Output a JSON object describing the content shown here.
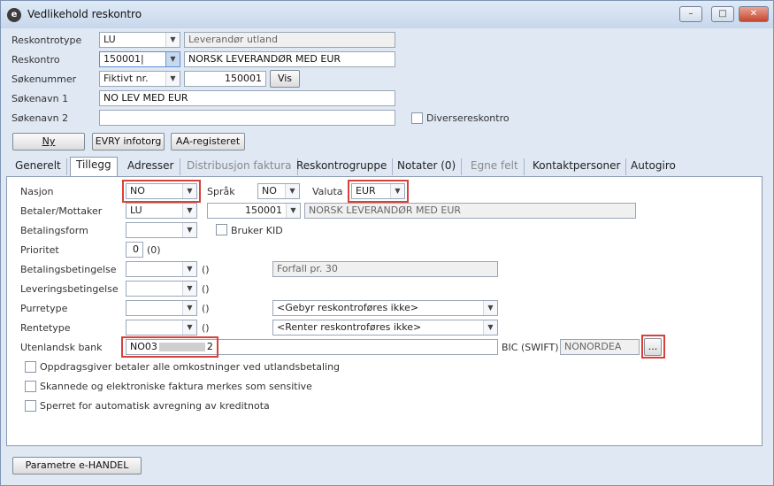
{
  "window": {
    "title": "Vedlikehold reskontro",
    "icon_letter": "e",
    "controls": {
      "minimize": "–",
      "maximize": "□",
      "close": "✕"
    }
  },
  "header": {
    "reskontrotype_label": "Reskontrotype",
    "reskontrotype_value": "LU",
    "reskontrotype_desc": "Leverandør utland",
    "reskontro_label": "Reskontro",
    "reskontro_value": "150001",
    "reskontro_name": "NORSK LEVERANDØR MED EUR",
    "sokenummer_label": "Søkenummer",
    "sokenummer_type": "Fiktivt nr.",
    "sokenummer_value": "150001",
    "vis_button": "Vis",
    "sokenavn1_label": "Søkenavn 1",
    "sokenavn1_value": "NO LEV MED EUR",
    "sokenavn2_label": "Søkenavn 2",
    "sokenavn2_value": "",
    "diverse_label": "Diversereskontro",
    "ny_button": "Ny",
    "evry_button": "EVRY infotorg",
    "aa_button": "AA-registeret"
  },
  "tabs": [
    {
      "label": "Generelt"
    },
    {
      "label": "Tillegg"
    },
    {
      "label": "Adresser"
    },
    {
      "label": "Distribusjon faktura"
    },
    {
      "label": "Reskontrogruppe"
    },
    {
      "label": "Notater (0)"
    },
    {
      "label": "Egne felt"
    },
    {
      "label": "Kontaktpersoner"
    },
    {
      "label": "Autogiro"
    }
  ],
  "tillegg": {
    "nasjon_label": "Nasjon",
    "nasjon_value": "NO",
    "sprak_label": "Språk",
    "sprak_value": "NO",
    "valuta_label": "Valuta",
    "valuta_value": "EUR",
    "betaler_label": "Betaler/Mottaker",
    "betaler_type": "LU",
    "betaler_number": "150001",
    "betaler_name": "NORSK LEVERANDØR MED EUR",
    "betalingsform_label": "Betalingsform",
    "bruker_kid_label": "Bruker KID",
    "prioritet_label": "Prioritet",
    "prioritet_value": "0",
    "prioritet_paren": "(0)",
    "betalingsbet_label": "Betalingsbetingelse",
    "betalingsbet_paren": "()",
    "forfall_text": "Forfall pr. 30",
    "leveringsbet_label": "Leveringsbetingelse",
    "leveringsbet_paren": "()",
    "purretype_label": "Purretype",
    "purretype_paren": "()",
    "gebyr_option": "<Gebyr reskontroføres ikke>",
    "rentetype_label": "Rentetype",
    "rentetype_paren": "()",
    "renter_option": "<Renter reskontroføres ikke>",
    "utenlandsk_label": "Utenlandsk bank",
    "bank_prefix": "NO03",
    "bank_suffix": "2",
    "bic_label": "BIC (SWIFT)",
    "bic_value": "NONORDEA",
    "bic_button": "...",
    "check1_label": "Oppdragsgiver betaler alle omkostninger ved utlandsbetaling",
    "check2_label": "Skannede og elektroniske faktura merkes som sensitive",
    "check3_label": "Sperret for automatisk avregning av kreditnota"
  },
  "footer": {
    "parametre_button": "Parametre e-HANDEL"
  },
  "colors": {
    "highlight_border": "#d8413a",
    "window_bg": "#e3ebf5",
    "tab_panel_bg": "#ffffff"
  }
}
